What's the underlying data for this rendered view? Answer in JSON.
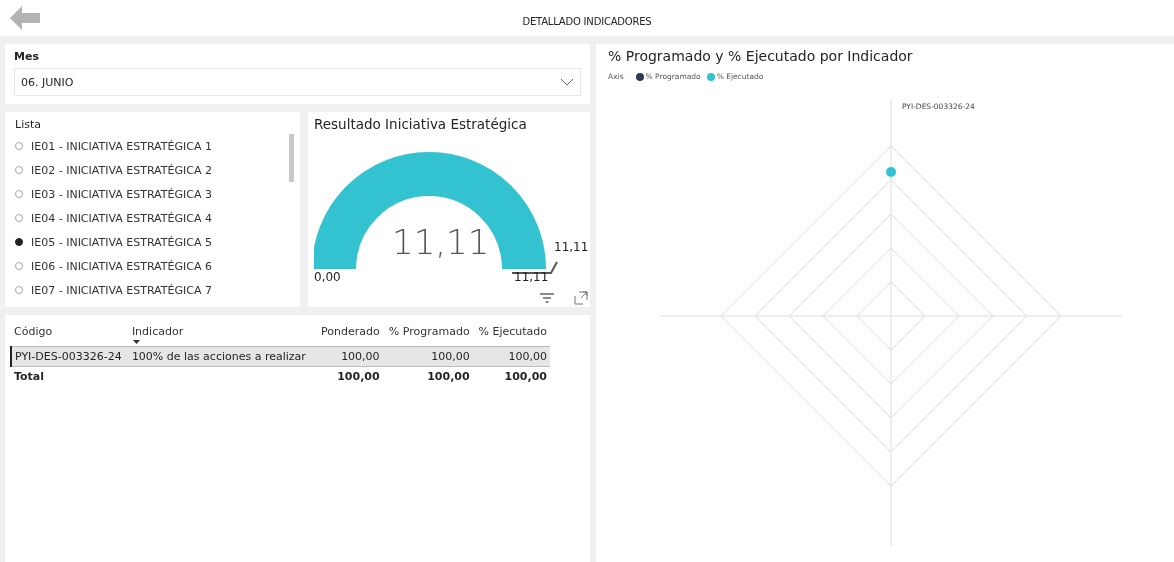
{
  "header": {
    "title": "DETALLADO INDICADORES"
  },
  "month_slicer": {
    "label": "Mes",
    "value": "06. JUNIO"
  },
  "list_slicer": {
    "label": "Lista",
    "items": [
      {
        "label": "IE01 - INICIATIVA ESTRATÉGICA 1",
        "selected": false
      },
      {
        "label": "IE02 - INICIATIVA ESTRATÉGICA 2",
        "selected": false
      },
      {
        "label": "IE03 - INICIATIVA ESTRATÉGICA 3",
        "selected": false
      },
      {
        "label": "IE04 - INICIATIVA ESTRATÉGICA 4",
        "selected": false
      },
      {
        "label": "IE05 - INICIATIVA ESTRATÉGICA 5",
        "selected": true
      },
      {
        "label": "IE06 - INICIATIVA ESTRATÉGICA 6",
        "selected": false
      },
      {
        "label": "IE07 - INICIATIVA ESTRATÉGICA 7",
        "selected": false
      }
    ]
  },
  "gauge": {
    "title": "Resultado Iniciativa Estratégica",
    "value": "11,11",
    "min": "0,00",
    "max": "11,11",
    "target": "11,11"
  },
  "table": {
    "columns": [
      "Código",
      "Indicador",
      "Ponderado",
      "% Programado",
      "% Ejecutado"
    ],
    "rows": [
      [
        "PYI-DES-003326-24",
        "100% de las acciones a realizar",
        "100,00",
        "100,00",
        "100,00"
      ]
    ],
    "total": {
      "label": "Total",
      "values": [
        "100,00",
        "100,00",
        "100,00"
      ]
    }
  },
  "radar": {
    "title": "% Programado y % Ejecutado por Indicador",
    "legend_title": "Axis",
    "legend": [
      {
        "label": "% Programado",
        "color": "#2b3a55"
      },
      {
        "label": "% Ejecutado",
        "color": "#33c3d0"
      }
    ],
    "axis_label": "PYI-DES-003326-24"
  }
}
